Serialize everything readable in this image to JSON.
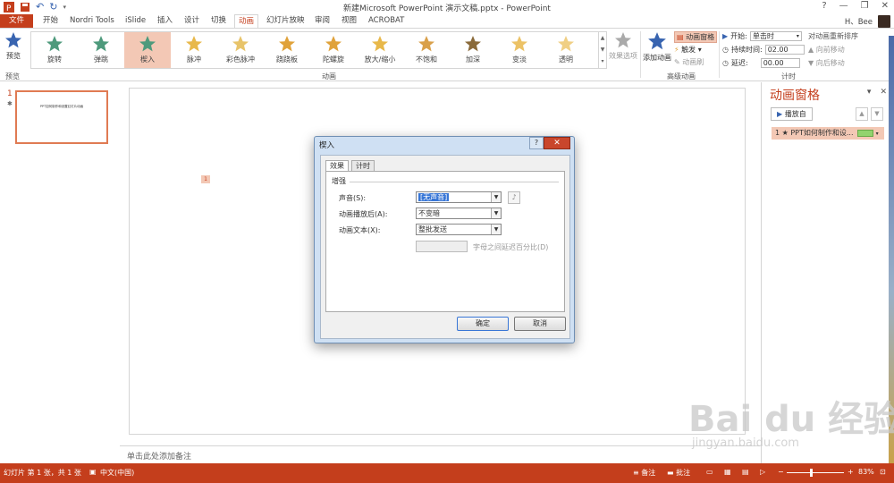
{
  "titlebar": {
    "title": "新建Microsoft PowerPoint 演示文稿.pptx - PowerPoint",
    "help": "?",
    "min": "—",
    "restore": "❐",
    "close": "✕"
  },
  "tabs": [
    "文件",
    "开始",
    "Nordri Tools",
    "iSlide",
    "插入",
    "设计",
    "切换",
    "动画",
    "幻灯片放映",
    "审阅",
    "视图",
    "ACROBAT"
  ],
  "user": "H、Bee",
  "ribbon": {
    "preview_label": "预览",
    "preview_group": "预览",
    "animation_group": "动画",
    "effects": [
      "旋转",
      "弹跳",
      "楔入",
      "脉冲",
      "彩色脉冲",
      "跷跷板",
      "陀螺旋",
      "放大/缩小",
      "不饱和",
      "加深",
      "变淡",
      "透明"
    ],
    "effect_options": "效果选项",
    "add_animation": "添加动画",
    "anim_pane_btn": "动画窗格",
    "trigger": "触发",
    "anim_painter": "动画刷",
    "advanced_group": "高级动画",
    "timing_group": "计时",
    "start_label": "开始:",
    "start_value": "单击时",
    "duration_label": "持续时间:",
    "duration_value": "02.00",
    "delay_label": "延迟:",
    "delay_value": "00.00",
    "reorder_title": "对动画重新排序",
    "move_earlier": "向前移动",
    "move_later": "向后移动"
  },
  "thumbnail": {
    "number": "1",
    "star": "✱",
    "text": "PPT如何制作和设置幻灯片动画"
  },
  "slide": {
    "tag": "1"
  },
  "notes": "单击此处添加备注",
  "anim_pane": {
    "title": "动画窗格",
    "play_from": "播放自",
    "item": "1 ★ PPT如何制作和设..."
  },
  "dialog": {
    "title": "楔入",
    "help": "?",
    "close": "✕",
    "tab_effect": "效果",
    "tab_timing": "计时",
    "section": "增强",
    "sound_label": "声音(S):",
    "sound_value": "[无声音]",
    "after_label": "动画播放后(A):",
    "after_value": "不变暗",
    "text_label": "动画文本(X):",
    "text_value": "整批发送",
    "spin_label": "字母之间延迟百分比(D)",
    "ok": "确定",
    "cancel": "取消"
  },
  "status": {
    "slide_info": "幻灯片 第 1 张，共 1 张",
    "lang": "中文(中国)",
    "notes": "备注",
    "comments": "批注",
    "zoom": "83%"
  },
  "watermark": {
    "big": "Bai du 经验",
    "small": "jingyan.baidu.com"
  },
  "colors": {
    "accent": "#c43e1c",
    "selection": "#f3c8b5"
  }
}
